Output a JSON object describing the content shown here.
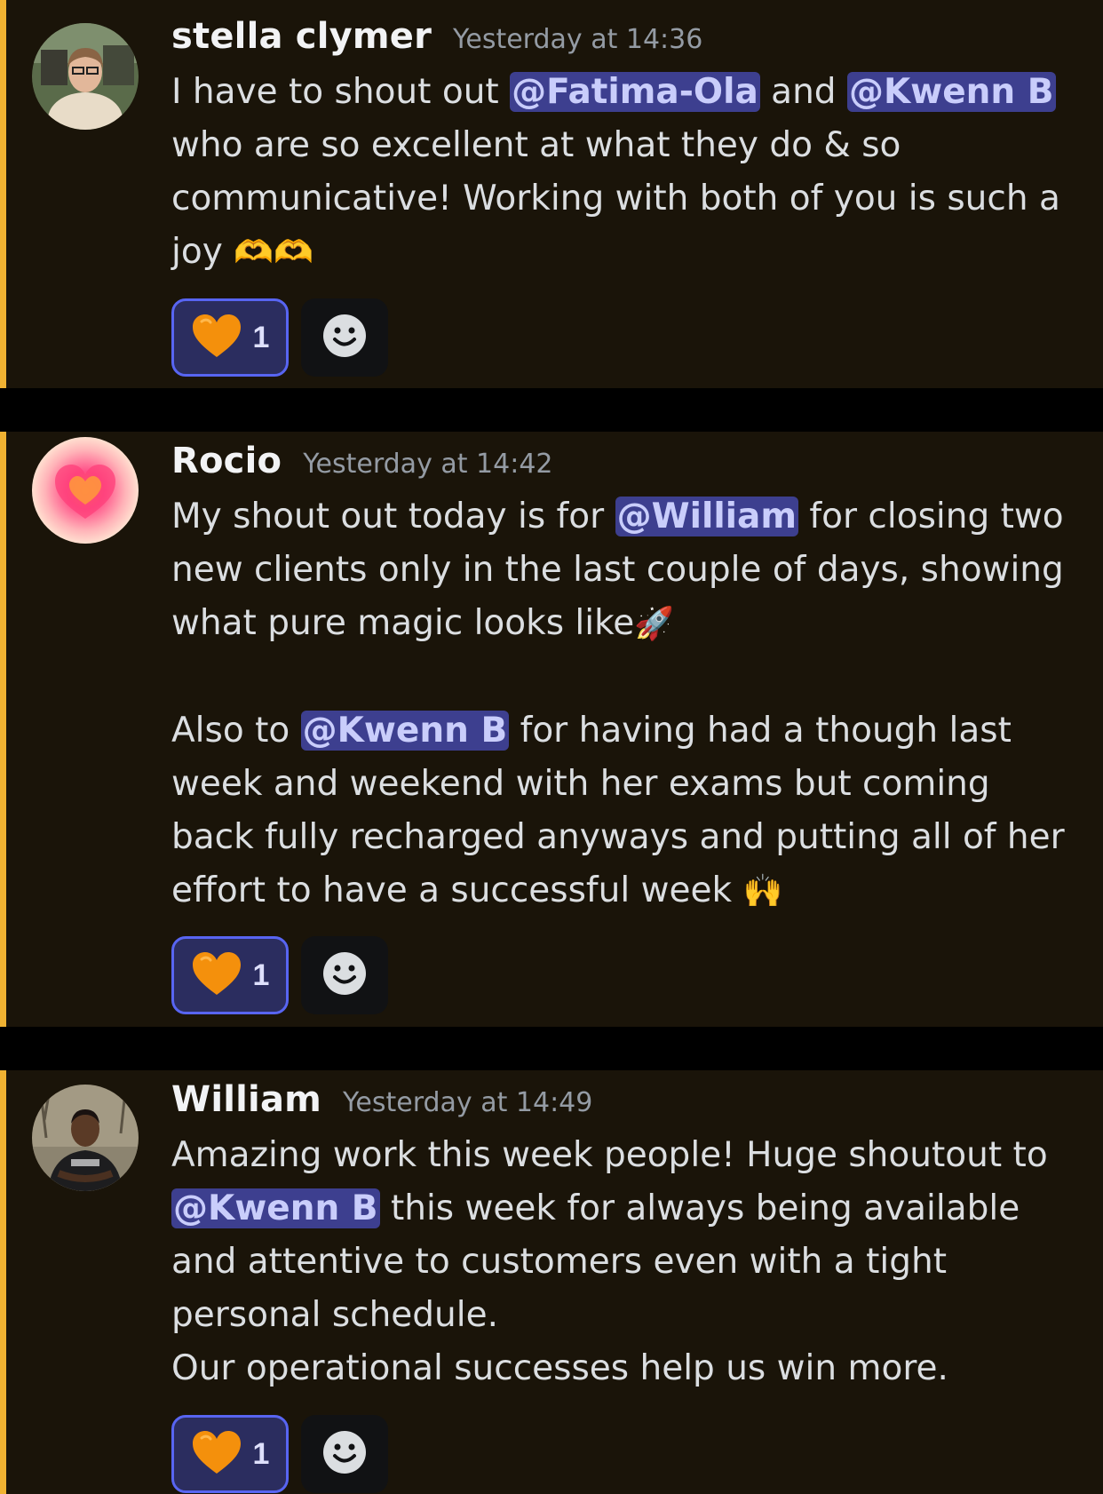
{
  "messages": [
    {
      "username": "stella clymer",
      "timestamp": "Yesterday at 14:36",
      "content": {
        "t1": "I have to shout out ",
        "m1": "@Fatima-Ola",
        "t2": " and ",
        "m2": "@Kwenn B",
        "t3": " who are so excellent at what they do & so communicative! Working with both of you is such a joy ",
        "e1": "🫶🫶"
      },
      "reaction": {
        "emoji": "🧡",
        "count": "1"
      }
    },
    {
      "username": "Rocio",
      "timestamp": "Yesterday at 14:42",
      "content": {
        "t1": "My shout out today is for ",
        "m1": "@William",
        "t2": " for closing two new clients only in the last couple of days, showing what pure magic looks like",
        "e1": "🚀",
        "t3": "Also to ",
        "m2": "@Kwenn B",
        "t4": " for having had a though last week and weekend with her exams but coming back fully recharged anyways and putting all of her effort to have a successful week ",
        "e2": "🙌"
      },
      "reaction": {
        "emoji": "🧡",
        "count": "1"
      }
    },
    {
      "username": "William",
      "timestamp": "Yesterday at 14:49",
      "content": {
        "t1": "Amazing work this week people! Huge shoutout to ",
        "m1": "@Kwenn B",
        "t2": " this week for always being available and attentive to customers even with a tight personal schedule.",
        "t3": "Our operational successes help us win more."
      },
      "reaction": {
        "emoji": "🧡",
        "count": "1"
      }
    }
  ],
  "icons": {
    "add_reaction": "smiley-face-icon",
    "heart": "orange-heart-icon"
  },
  "colors": {
    "highlight_bar": "#f0b232",
    "message_bg": "#1a1409",
    "mention_bg": "#3d3f8f",
    "mention_text": "#c9cdfb",
    "reaction_border": "#5865f2"
  }
}
